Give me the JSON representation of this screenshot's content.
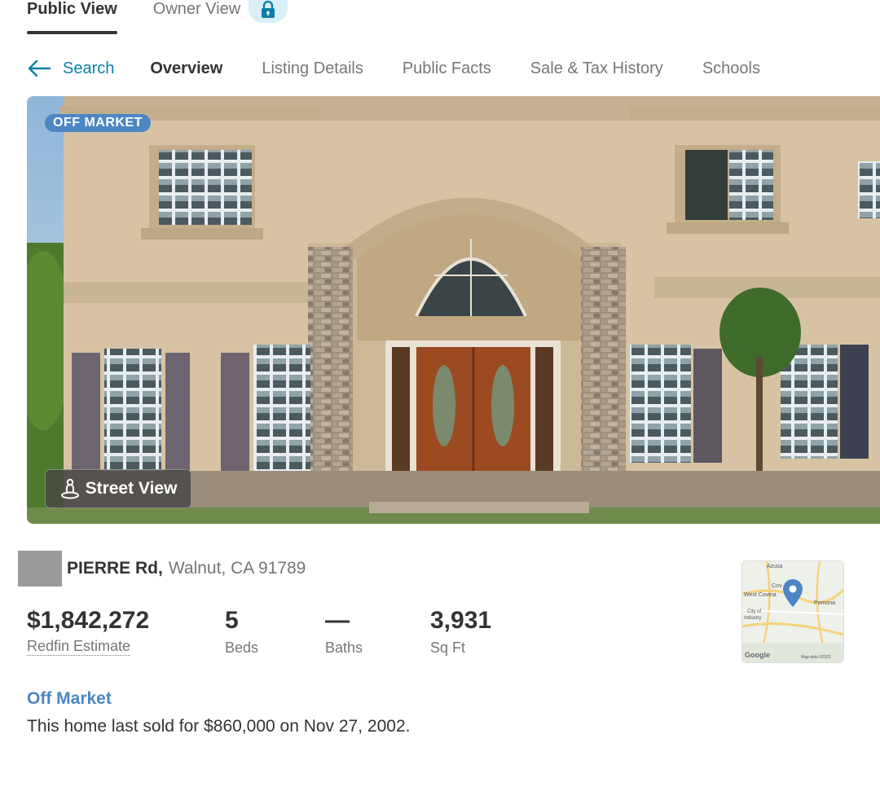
{
  "view_tabs": {
    "public": "Public View",
    "owner": "Owner View"
  },
  "icons": {
    "lock": "lock-icon",
    "back": "arrow-left-icon",
    "street": "pegman-icon",
    "pin": "map-pin-icon"
  },
  "colors": {
    "accent": "#0d7fa6",
    "badge": "#4c86c4",
    "lock_bg": "#d9eef6"
  },
  "subnav": {
    "back_label": "Search",
    "items": [
      "Overview",
      "Listing Details",
      "Public Facts",
      "Sale & Tax History",
      "Schools"
    ]
  },
  "photo": {
    "badge": "OFF MARKET",
    "street_view_label": "Street View"
  },
  "address": {
    "street": "PIERRE Rd,",
    "city": "Walnut, CA 91789"
  },
  "stats": {
    "price": {
      "value": "$1,842,272",
      "label": "Redfin Estimate"
    },
    "beds": {
      "value": "5",
      "label": "Beds"
    },
    "baths": {
      "value": "—",
      "label": "Baths"
    },
    "sqft": {
      "value": "3,931",
      "label": "Sq Ft"
    }
  },
  "map": {
    "labels": [
      "Azusa",
      "Cov",
      "West Covina",
      "Pomona",
      "City of",
      "Industry",
      "Google",
      "Map data ©2021"
    ]
  },
  "status": {
    "title": "Off Market",
    "description": "This home last sold for $860,000 on Nov 27, 2002."
  }
}
